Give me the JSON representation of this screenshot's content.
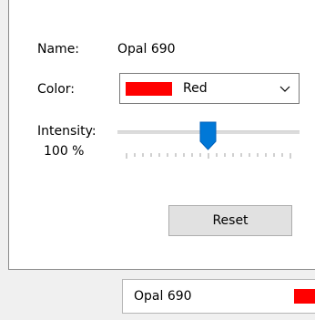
{
  "name_label": "Name:",
  "name_value": "Opal 690",
  "color_label": "Color:",
  "color": {
    "selected": "Red",
    "swatch_hex": "#ff0000"
  },
  "intensity_label": "Intensity:",
  "intensity_value_text": "100 %",
  "intensity_percent": 100,
  "reset_label": "Reset",
  "status": {
    "name": "Opal 690",
    "swatch_hex": "#ff0000"
  },
  "icons": {
    "dropdown": "chevron-down-icon",
    "slider_thumb": "slider-thumb"
  },
  "colors": {
    "accent": "#0078d7",
    "panel": "#ffffff",
    "background": "#f0f0f0"
  }
}
